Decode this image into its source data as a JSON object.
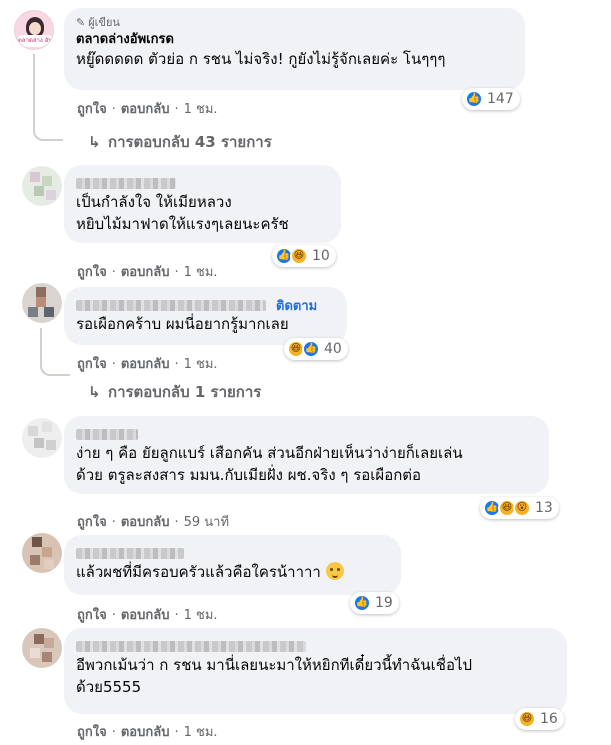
{
  "comments": [
    {
      "author": "ตลาดล่างอัพเกรด",
      "badge": "ผู้เขียน",
      "avatar_tag": "ตลาดล่าง อัพเกรด",
      "lines": [
        "หยู๊ดดดดด ตัวย่อ ก รชน ไม่จริง! กูยังไม่รู้จักเลยค่ะ โนๆๆๆ"
      ],
      "like": "ถูกใจ",
      "reply": "ตอบกลับ",
      "time": "1 ชม.",
      "reactions": [
        "like"
      ],
      "reaction_count": "147",
      "replies_label": "การตอบกลับ 43 รายการ"
    },
    {
      "lines": [
        "เป็นกำลังใจ ให้เมียหลวง",
        "หยิบไม้มาฟาดให้แรงๆเลยนะครัช"
      ],
      "like": "ถูกใจ",
      "reply": "ตอบกลับ",
      "time": "1 ชม.",
      "reactions": [
        "like",
        "haha"
      ],
      "reaction_count": "10"
    },
    {
      "follow": "ติดตาม",
      "lines": [
        "รอเผือกคร้าบ ผมนี่อยากรู้มากเลย"
      ],
      "like": "ถูกใจ",
      "reply": "ตอบกลับ",
      "time": "1 ชม.",
      "reactions": [
        "haha",
        "like"
      ],
      "reaction_count": "40",
      "replies_label": "การตอบกลับ 1 รายการ"
    },
    {
      "lines": [
        "ง่าย ๆ คือ ยัยลูกแบร์ เสือกคัน ส่วนอีกฝ่ายเห็นว่าง่ายก็เลยเล่น",
        "ด้วย ตรูละสงสาร มมน.กับเมียฝั่ง ผช.จริง ๆ รอเผือกต่อ"
      ],
      "like": "ถูกใจ",
      "reply": "ตอบกลับ",
      "time": "59 นาที",
      "reactions": [
        "like",
        "haha",
        "wow"
      ],
      "reaction_count": "13"
    },
    {
      "lines": [
        "แล้วผชที่มีครอบครัวแล้วคือใครน้าาาา"
      ],
      "like": "ถูกใจ",
      "reply": "ตอบกลับ",
      "time": "1 ชม.",
      "reactions": [
        "like"
      ],
      "reaction_count": "19"
    },
    {
      "lines": [
        "อีพวกเม้นว่า ก รชน มานี่เลยนะมาให้หยิกทีเดี๋ยวนี้ทำฉันเชื่อไป",
        "ด้วย5555"
      ],
      "like": "ถูกใจ",
      "reply": "ตอบกลับ",
      "time": "1 ชม.",
      "reactions": [
        "haha"
      ],
      "reaction_count": "16"
    }
  ],
  "icons": {
    "author_badge": "pencil-icon",
    "reply_arrow": "reply-arrow-icon",
    "like": "like-reaction-icon",
    "haha": "haha-reaction-icon",
    "wow": "wow-reaction-icon"
  },
  "colors": {
    "bubble": "#f0f2f5",
    "like_blue": "#1877f2",
    "follow_blue": "#216fdb",
    "meta_gray": "#65676b"
  }
}
